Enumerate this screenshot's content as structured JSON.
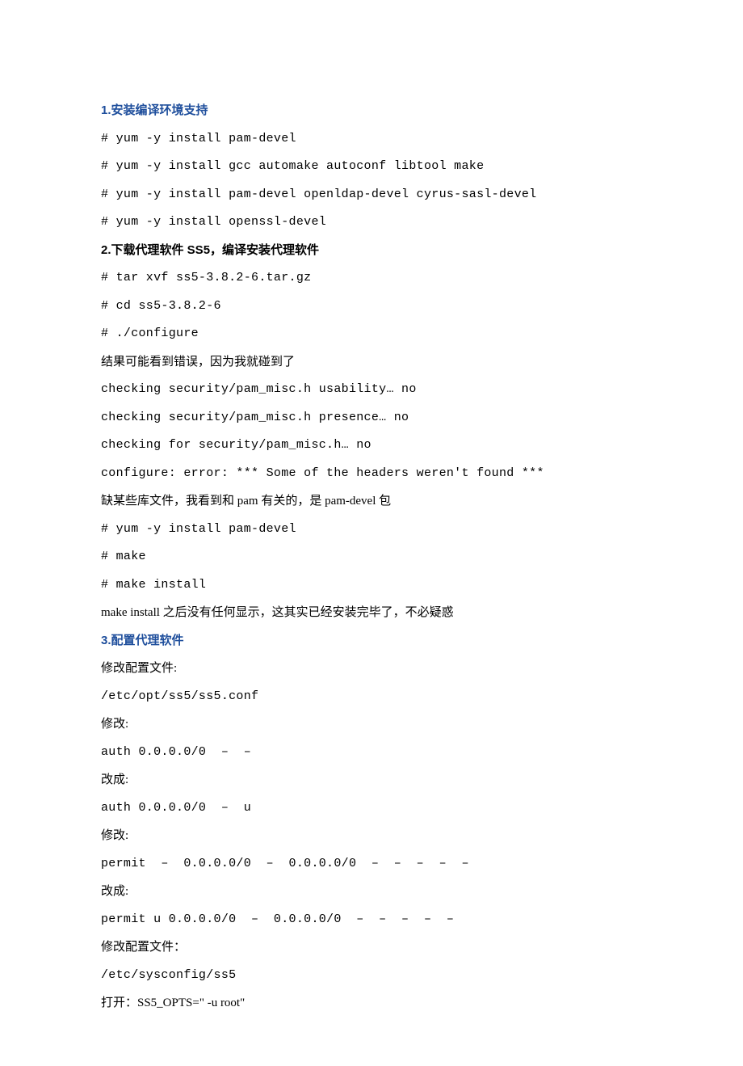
{
  "sections": {
    "s1": {
      "title": "1.安装编译环境支持",
      "lines": [
        "# yum -y install pam-devel",
        "# yum -y install gcc automake autoconf libtool make",
        "# yum -y install pam-devel openldap-devel cyrus-sasl-devel",
        "# yum -y install openssl-devel"
      ]
    },
    "s2": {
      "title": "2.下载代理软件 SS5，编译安装代理软件",
      "lines": [
        "# tar xvf ss5-3.8.2-6.tar.gz",
        "# cd ss5-3.8.2-6",
        "# ./configure",
        "结果可能看到错误，因为我就碰到了",
        "checking security/pam_misc.h usability… no",
        "checking security/pam_misc.h presence… no",
        "checking for security/pam_misc.h… no",
        "configure: error: *** Some of the headers weren't found ***",
        "缺某些库文件，我看到和 pam 有关的，是 pam-devel 包",
        "# yum -y install pam-devel",
        "# make",
        "# make install",
        "make install 之后没有任何显示，这其实已经安装完毕了，不必疑惑"
      ]
    },
    "s3": {
      "title": "3.配置代理软件",
      "lines": [
        "修改配置文件:",
        "/etc/opt/ss5/ss5.conf",
        "修改:",
        "auth 0.0.0.0/0  –  –",
        "改成:",
        "auth 0.0.0.0/0  –  u",
        "修改:",
        "permit  –  0.0.0.0/0  –  0.0.0.0/0  –  –  –  –  –",
        "改成:",
        "permit u 0.0.0.0/0  –  0.0.0.0/0  –  –  –  –  –",
        "修改配置文件：",
        "/etc/sysconfig/ss5",
        "打开：SS5_OPTS=\" -u root\""
      ]
    }
  }
}
